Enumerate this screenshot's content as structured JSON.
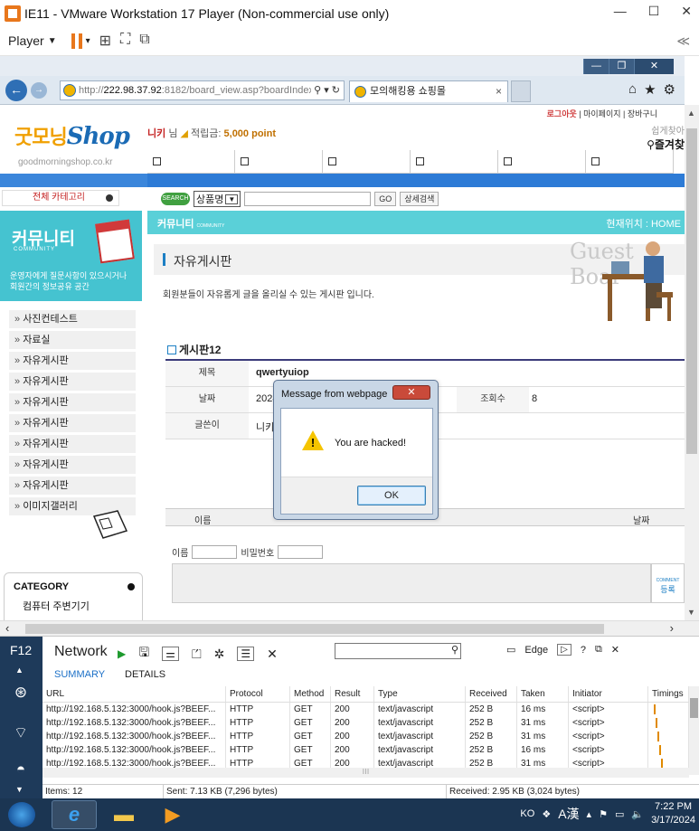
{
  "vmware": {
    "title": "IE11 - VMware Workstation 17 Player (Non-commercial use only)",
    "player_label": "Player",
    "controls": [
      "minimize",
      "maximize",
      "close"
    ],
    "collapse_label": "≪"
  },
  "ie": {
    "address_prefix": "http://",
    "address_host": "222.98.37.92",
    "address_rest": ":8182/board_view.asp?boardIndex",
    "address_icons": "⚲ ▾ ↻",
    "tab_title": "모의해킹용 쇼핑몰",
    "tab_close": "×"
  },
  "site": {
    "logo": "굿모닝",
    "logo_s": "Shop",
    "logo_sub": "goodmorningshop.co.kr",
    "user_name": "니키",
    "user_suffix": "님",
    "points_label": "적립금:",
    "points_value": "5,000 point",
    "top_links": {
      "logout": "로그아웃",
      "mypage": "마이페이지",
      "cart": "장바구니"
    },
    "fav_small": "쉽게찾아",
    "fav_label": "즐겨찾",
    "all_categories": "전체 카테고리",
    "search_badge": "SEARCH",
    "search_select": "상품명",
    "go_button": "GO",
    "detail_search_button": "상세검색"
  },
  "sidebar": {
    "title": "커뮤니티",
    "subtitle": "COMMUNITY",
    "desc_line1": "운영자에게 질문사항이 있으시거나",
    "desc_line2": "회원간의 정보공유 공간",
    "items": [
      "사진컨테스트",
      "자료실",
      "자유게시판",
      "자유게시판",
      "자유게시판",
      "자유게시판",
      "자유게시판",
      "자유게시판",
      "자유게시판",
      "이미지갤러리"
    ],
    "category_title": "CATEGORY",
    "category_first": "컴퓨터 주변기기"
  },
  "main": {
    "section": "커뮤니티",
    "section_small": "COMMUNITY",
    "location": "현재위치 : HOME",
    "board_title": "자유게시판",
    "guest_text": "Guest Boar",
    "description": "회원분들이 자유롭게 글을 올리실 수 있는 게시판 입니다.",
    "post_header": "게시판12",
    "labels": {
      "subject": "제목",
      "date": "날짜",
      "views": "조회수",
      "author": "글쓴이"
    },
    "values": {
      "subject": "qwertyuiop",
      "date": "2024",
      "views": "8",
      "author": "니키"
    },
    "comment_head": {
      "name": "이름",
      "date": "날짜"
    },
    "comment_form": {
      "name": "이름",
      "password": "비밀번호"
    },
    "comment_button_small": "COMMENT",
    "comment_button": "등록"
  },
  "dialog": {
    "title": "Message from webpage",
    "message": "You are hacked!",
    "ok": "OK"
  },
  "devtools": {
    "f12": "F12",
    "panel": "Network",
    "tabs": [
      "SUMMARY",
      "DETAILS"
    ],
    "mode": "Edge",
    "help": "?",
    "columns": [
      "URL",
      "Protocol",
      "Method",
      "Result",
      "Type",
      "Received",
      "Taken",
      "Initiator",
      "Timings"
    ],
    "rows": [
      [
        "http://192.168.5.132:3000/hook.js?BEEF...",
        "HTTP",
        "GET",
        "200",
        "text/javascript",
        "252 B",
        "16 ms",
        "<script>"
      ],
      [
        "http://192.168.5.132:3000/hook.js?BEEF...",
        "HTTP",
        "GET",
        "200",
        "text/javascript",
        "252 B",
        "31 ms",
        "<script>"
      ],
      [
        "http://192.168.5.132:3000/hook.js?BEEF...",
        "HTTP",
        "GET",
        "200",
        "text/javascript",
        "252 B",
        "31 ms",
        "<script>"
      ],
      [
        "http://192.168.5.132:3000/hook.js?BEEF...",
        "HTTP",
        "GET",
        "200",
        "text/javascript",
        "252 B",
        "16 ms",
        "<script>"
      ],
      [
        "http://192.168.5.132:3000/hook.js?BEEF...",
        "HTTP",
        "GET",
        "200",
        "text/javascript",
        "252 B",
        "31 ms",
        "<script>"
      ]
    ],
    "status_items": "Items: 12",
    "status_sent": "Sent: 7.13 KB (7,296 bytes)",
    "status_received": "Received: 2.95 KB (3,024 bytes)"
  },
  "taskbar": {
    "ime": "KO",
    "ime_mode": "A漢",
    "time": "7:22 PM",
    "date": "3/17/2024"
  }
}
